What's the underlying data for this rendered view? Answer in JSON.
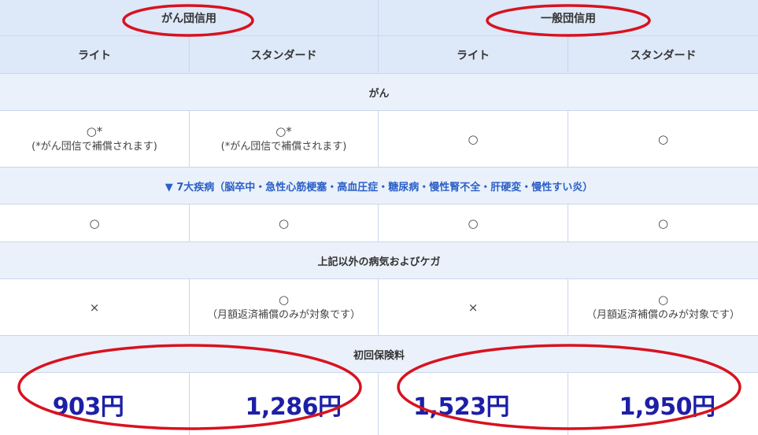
{
  "header": {
    "groups": [
      "がん団信用",
      "一般団信用"
    ],
    "plans": [
      "ライト",
      "スタンダード",
      "ライト",
      "スタンダード"
    ]
  },
  "sections": [
    {
      "title": "がん",
      "cells": [
        {
          "symbol": "○*",
          "note": "(*がん団信で補償されます)"
        },
        {
          "symbol": "○*",
          "note": "(*がん団信で補償されます)"
        },
        {
          "symbol": "○",
          "note": ""
        },
        {
          "symbol": "○",
          "note": ""
        }
      ]
    },
    {
      "title": "▼ 7大疾病（脳卒中・急性心筋梗塞・高血圧症・糖尿病・慢性腎不全・肝硬変・慢性すい炎）",
      "cells": [
        {
          "symbol": "○",
          "note": ""
        },
        {
          "symbol": "○",
          "note": ""
        },
        {
          "symbol": "○",
          "note": ""
        },
        {
          "symbol": "○",
          "note": ""
        }
      ]
    },
    {
      "title": "上記以外の病気およびケガ",
      "cells": [
        {
          "symbol": "×",
          "note": ""
        },
        {
          "symbol": "○",
          "note": "（月額返済補償のみが対象です）"
        },
        {
          "symbol": "×",
          "note": ""
        },
        {
          "symbol": "○",
          "note": "（月額返済補償のみが対象です）"
        }
      ]
    }
  ],
  "premium": {
    "title": "初回保険料",
    "prices": [
      "903円",
      "1,286円",
      "1,523円",
      "1,950円"
    ]
  },
  "colors": {
    "header_bg": "#dde8f8",
    "section_bg": "#eaf1fb",
    "border": "#c9d7ec",
    "link_blue": "#2b5fc6",
    "price_blue": "#1d1fa6",
    "annotation_red": "#d8121f"
  }
}
